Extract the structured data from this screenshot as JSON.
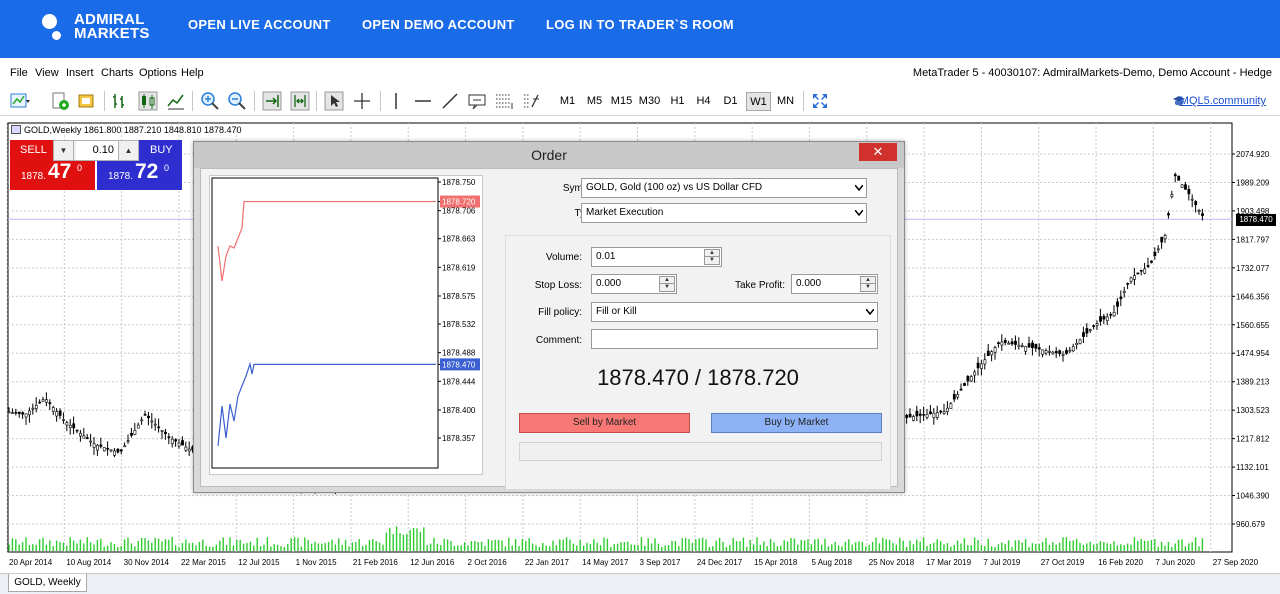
{
  "site_nav": {
    "logo_line1": "ADMIRAL",
    "logo_line2": "MARKETS",
    "links": [
      "OPEN LIVE ACCOUNT",
      "OPEN DEMO ACCOUNT",
      "LOG IN TO TRADER`S ROOM"
    ]
  },
  "menu": {
    "items": [
      "File",
      "View",
      "Insert",
      "Charts",
      "Options",
      "Help"
    ],
    "window_title": "MetaTrader 5 - 40030107: AdmiralMarkets-Demo, Demo Account - Hedge"
  },
  "toolbar": {
    "timeframes": [
      "M1",
      "M5",
      "M15",
      "M30",
      "H1",
      "H4",
      "D1",
      "W1",
      "MN"
    ],
    "active_timeframe": "W1",
    "mql_link": "MQL5.community"
  },
  "chart": {
    "title": "GOLD,Weekly  1861.800 1887.210 1848.810 1878.470",
    "current_price": "1878.470",
    "tab_label": "GOLD, Weekly",
    "one_click": {
      "sell_label": "SELL",
      "buy_label": "BUY",
      "volume": "0.10",
      "sell_prefix": "1878.",
      "sell_big": "47",
      "sell_sup": "0",
      "buy_prefix": "1878.",
      "buy_big": "72",
      "buy_sup": "0"
    },
    "colors": {
      "sell": "#e01010",
      "buy": "#2e2ed0",
      "volume": "#2ecc2e"
    }
  },
  "chart_data": {
    "type": "line",
    "y_axis_ticks": [
      "2074.920",
      "1989.209",
      "1903.498",
      "1817.797",
      "1732.077",
      "1646.356",
      "1560.655",
      "1474.954",
      "1389.213",
      "1303.523",
      "1217.812",
      "1132.101",
      "1046.390",
      "960.679"
    ],
    "x_axis_ticks": [
      "20 Apr 2014",
      "10 Aug 2014",
      "30 Nov 2014",
      "22 Mar 2015",
      "12 Jul 2015",
      "1 Nov 2015",
      "21 Feb 2016",
      "12 Jun 2016",
      "2 Oct 2016",
      "22 Jan 2017",
      "14 May 2017",
      "3 Sep 2017",
      "24 Dec 2017",
      "15 Apr 2018",
      "5 Aug 2018",
      "25 Nov 2018",
      "17 Mar 2019",
      "7 Jul 2019",
      "27 Oct 2019",
      "16 Feb 2020",
      "7 Jun 2020",
      "27 Sep 2020"
    ],
    "ylim": [
      960.679,
      2074.92
    ],
    "current_price": 1878.47
  },
  "order_dialog": {
    "title": "Order",
    "close_label": "✕",
    "symbol_label": "Symbol:",
    "symbol_value": "GOLD, Gold (100 oz) vs US Dollar CFD",
    "type_label": "Type:",
    "type_value": "Market Execution",
    "volume_label": "Volume:",
    "volume_value": "0.01",
    "stop_loss_label": "Stop Loss:",
    "stop_loss_value": "0.000",
    "take_profit_label": "Take Profit:",
    "take_profit_value": "0.000",
    "fill_policy_label": "Fill policy:",
    "fill_policy_value": "Fill or Kill",
    "comment_label": "Comment:",
    "comment_value": "",
    "price_display": "1878.470 / 1878.720",
    "sell_button": "Sell by Market",
    "buy_button": "Buy by Market",
    "tick_chart": {
      "y_ticks": [
        "1878.750",
        "1878.720",
        "1878.706",
        "1878.663",
        "1878.619",
        "1878.575",
        "1878.532",
        "1878.488",
        "1878.470",
        "1878.444",
        "1878.400",
        "1878.357"
      ],
      "ask_label": "1878.720",
      "bid_label": "1878.470",
      "ask_color": "#f07070",
      "bid_color": "#3a5fd0"
    }
  }
}
